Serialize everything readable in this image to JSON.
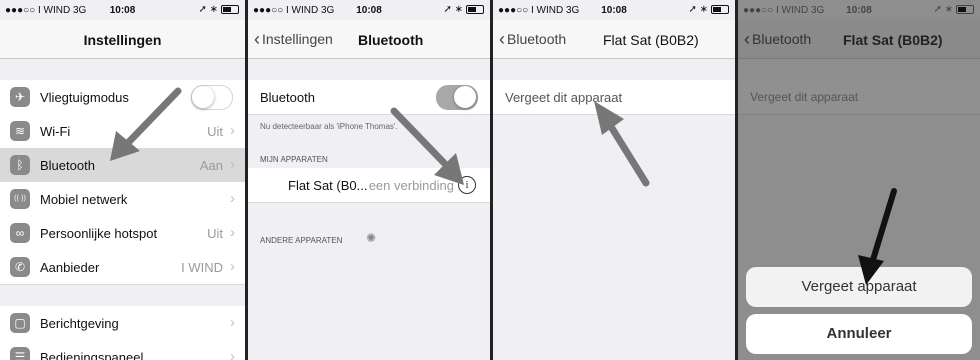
{
  "status_bar": {
    "carrier": "●●●○○ I WIND  3G",
    "time": "10:08",
    "right_icons": "➚ ∗"
  },
  "panel1": {
    "title": "Instellingen",
    "rows": [
      {
        "label": "Vliegtuigmodus",
        "value": "",
        "icon": "airplane-icon",
        "glyph": "✈"
      },
      {
        "label": "Wi-Fi",
        "value": "Uit",
        "icon": "wifi-icon",
        "glyph": "≋"
      },
      {
        "label": "Bluetooth",
        "value": "Aan",
        "icon": "bluetooth-icon",
        "glyph": "ᛒ"
      },
      {
        "label": "Mobiel netwerk",
        "value": "",
        "icon": "antenna-icon",
        "glyph": "((·))"
      },
      {
        "label": "Persoonlijke hotspot",
        "value": "Uit",
        "icon": "link-icon",
        "glyph": "∞"
      },
      {
        "label": "Aanbieder",
        "value": "I WIND",
        "icon": "phone-icon",
        "glyph": "✆"
      },
      {
        "label": "Berichtgeving",
        "value": "",
        "icon": "notifications-icon",
        "glyph": "▢"
      },
      {
        "label": "Bedieningspaneel",
        "value": "",
        "icon": "control-center-icon",
        "glyph": "☰"
      }
    ]
  },
  "panel2": {
    "back": "Instellingen",
    "title": "Bluetooth",
    "bt_label": "Bluetooth",
    "discoverable": "Nu detecteerbaar als 'iPhone Thomas'.",
    "my_devices_header": "MIJN APPARATEN",
    "device_name": "Flat Sat (B0...",
    "device_status": "een verbinding",
    "other_devices_header": "ANDERE APPARATEN"
  },
  "panel3": {
    "back": "Bluetooth",
    "title": "Flat Sat  (B0B2)",
    "forget": "Vergeet dit apparaat"
  },
  "panel4": {
    "back": "Bluetooth",
    "title": "Flat Sat  (B0B2)",
    "forget": "Vergeet dit apparaat",
    "confirm": "Vergeet apparaat",
    "cancel": "Annuleer"
  }
}
